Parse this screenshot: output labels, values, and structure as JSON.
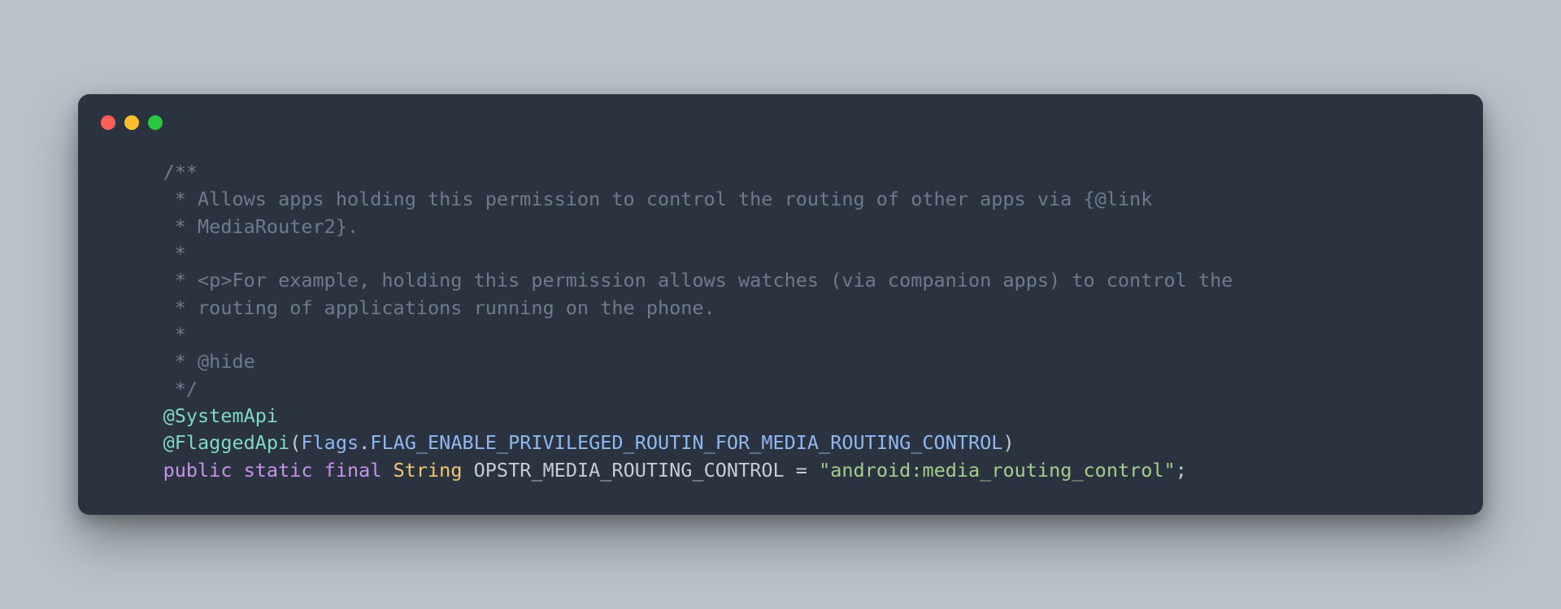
{
  "comment": {
    "open": "    /**",
    "l1": "     * Allows apps holding this permission to control the routing of other apps via {@link",
    "l2": "     * MediaRouter2}.",
    "l3": "     *",
    "l4": "     * <p>For example, holding this permission allows watches (via companion apps) to control the",
    "l5": "     * routing of applications running on the phone.",
    "l6": "     *",
    "l7": "     * @hide",
    "close": "     */"
  },
  "line_a": {
    "indent": "    ",
    "annotation": "@SystemApi"
  },
  "line_b": {
    "indent": "    ",
    "annotation": "@FlaggedApi",
    "open": "(",
    "ref1": "Flags",
    "dot": ".",
    "ref2": "FLAG_ENABLE_PRIVILEGED_ROUTIN_FOR_MEDIA_ROUTING_CONTROL",
    "close": ")"
  },
  "line_c": {
    "indent": "    ",
    "kw1": "public",
    "sp1": " ",
    "kw2": "static",
    "sp2": " ",
    "kw3": "final",
    "sp3": " ",
    "type": "String",
    "sp4": " ",
    "name": "OPSTR_MEDIA_ROUTING_CONTROL",
    "eq": " = ",
    "str": "\"android:media_routing_control\"",
    "semi": ";"
  }
}
